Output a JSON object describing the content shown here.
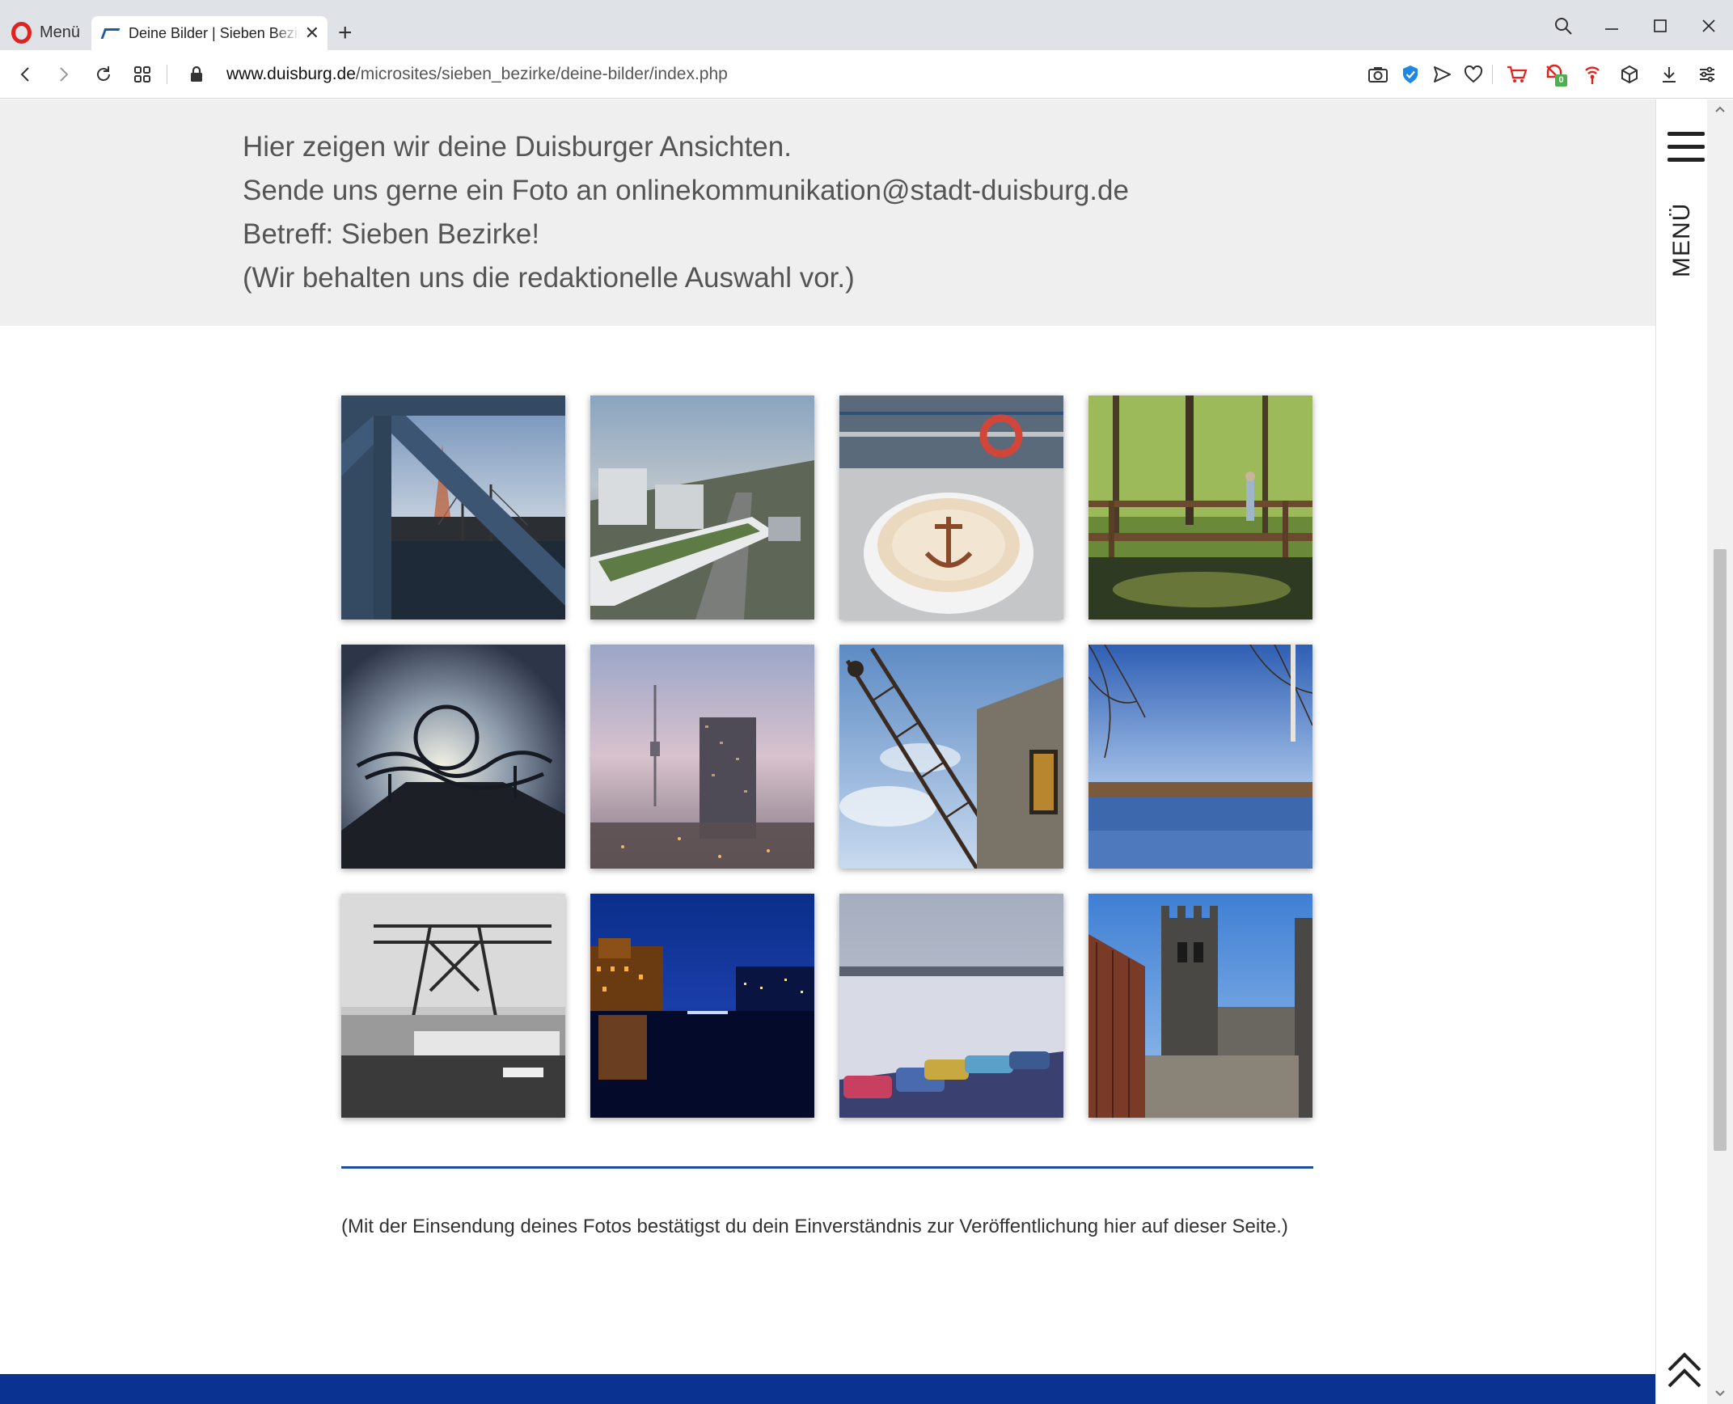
{
  "browser": {
    "menu_label": "Menü",
    "tab_title": "Deine Bilder | Sieben Bezirke",
    "url_domain": "www.duisburg.de",
    "url_path": "/microsites/sieben_bezirke/deine-bilder/index.php",
    "extensions": [
      "camera-icon",
      "shield-check-icon",
      "send-icon",
      "heart-icon",
      "cart-icon",
      "adblock-icon",
      "rss-icon",
      "cube-icon",
      "download-icon",
      "easy-setup-icon"
    ],
    "adblock_badge": "0",
    "colors": {
      "opera_red": "#e0231f",
      "badge_green": "#4caf50",
      "ext_red": "#e0231f"
    }
  },
  "intro": {
    "line1": "Hier zeigen wir deine Duisburger Ansichten.",
    "line2": "Sende uns gerne ein Foto an onlinekommunikation@stadt-duisburg.de",
    "line3": "Betreff: Sieben Bezirke!",
    "line4": "(Wir behalten uns die redaktionelle Auswahl vor.)"
  },
  "gallery": {
    "photos": [
      "photo-bridge-steel-truss",
      "photo-city-aerial-fog",
      "photo-cappuccino-anchor",
      "photo-forest-footbridge",
      "photo-tiger-turtle-landmark",
      "photo-tv-tower-misty-dusk",
      "photo-harbour-crane-wooden-house",
      "photo-lake-birch-blue-sky",
      "photo-industrial-crane-bw",
      "photo-inner-harbour-night",
      "photo-pedal-boats-lake",
      "photo-bridge-towers-brick"
    ]
  },
  "consent": "(Mit der Einsendung deines Fotos bestätigst du dein Einverständnis zur Veröffentlichung hier auf dieser Seite.)",
  "side_menu": {
    "label": "MENÜ"
  },
  "colors": {
    "footer_band": "#0a3291",
    "divider": "#1c4e9c",
    "intro_bg": "#efefef"
  }
}
